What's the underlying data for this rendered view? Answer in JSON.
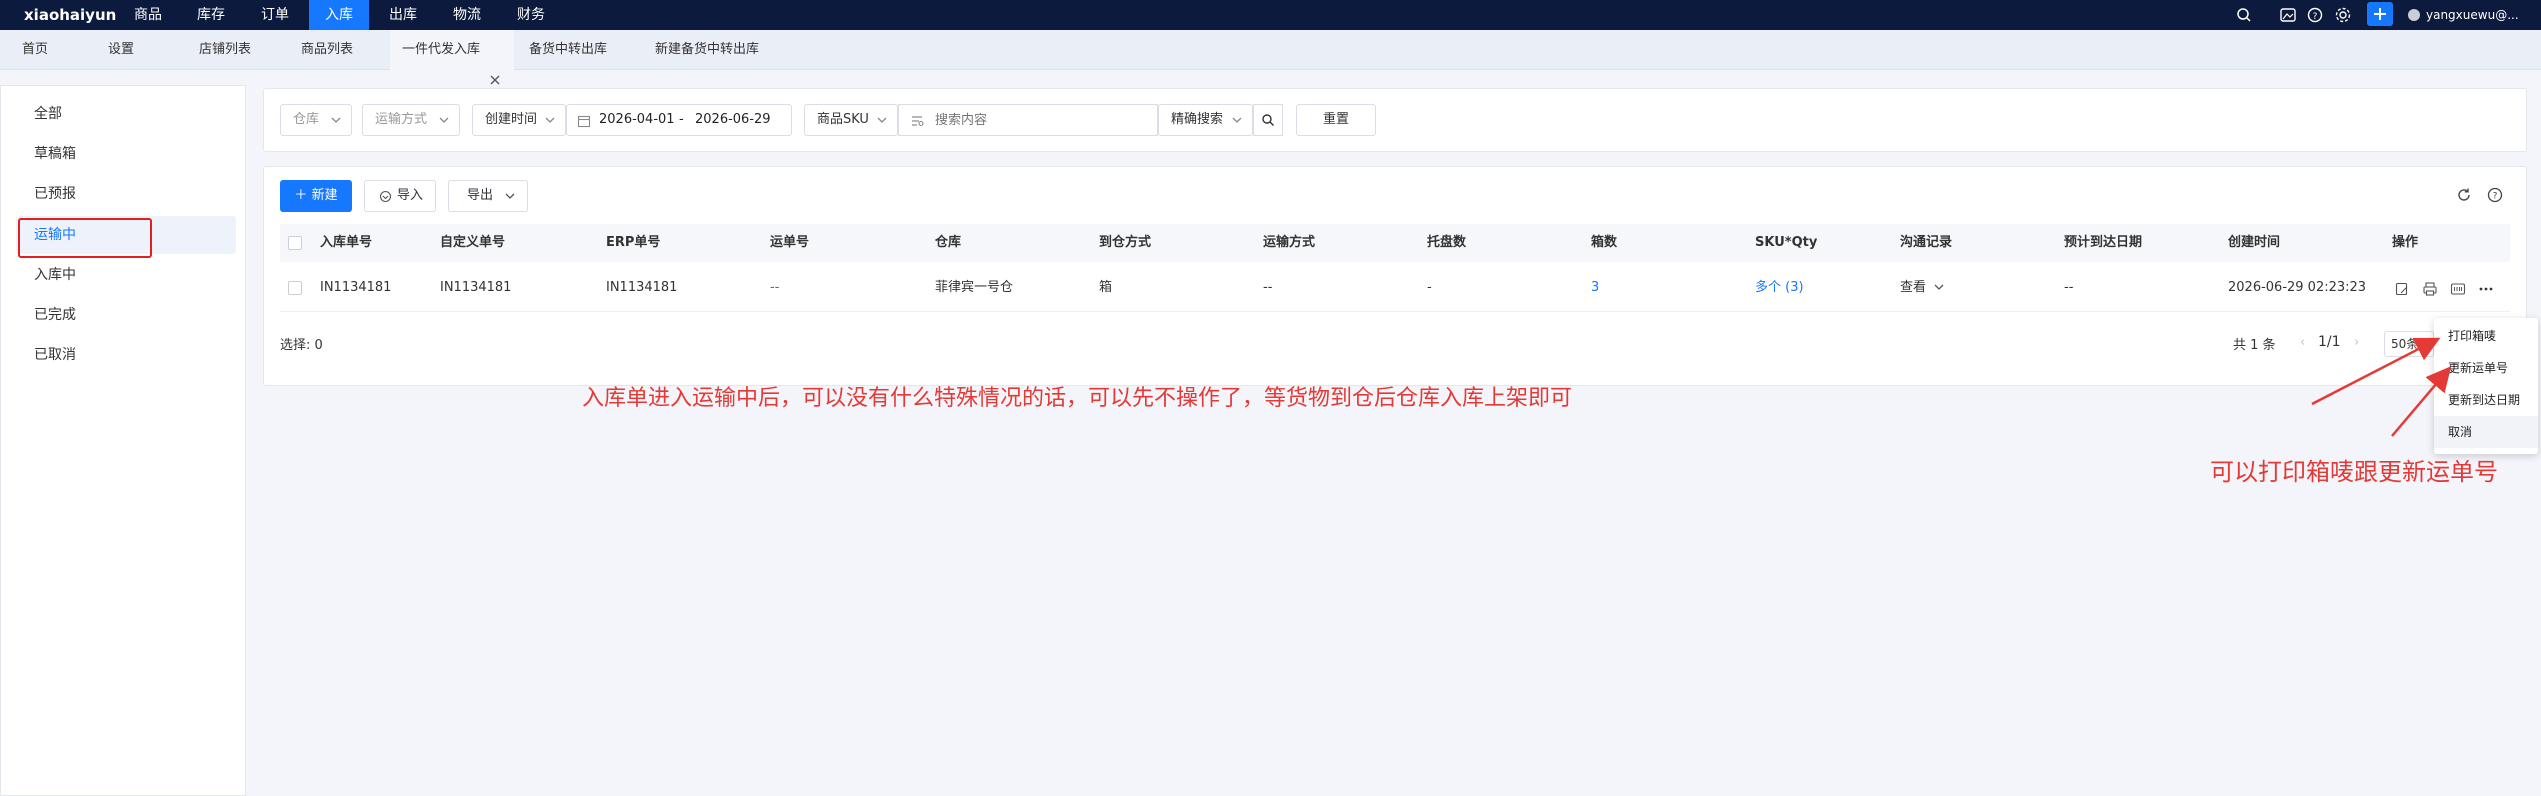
{
  "brand": "xiaohaiyun",
  "nav": [
    {
      "label": "商品"
    },
    {
      "label": "库存"
    },
    {
      "label": "订单"
    },
    {
      "label": "入库",
      "active": true
    },
    {
      "label": "出库"
    },
    {
      "label": "物流"
    },
    {
      "label": "财务"
    }
  ],
  "user": "yangxuewu@...",
  "tabs": [
    {
      "label": "首页"
    },
    {
      "label": "设置"
    },
    {
      "label": "店铺列表"
    },
    {
      "label": "商品列表"
    },
    {
      "label": "一件代发入库",
      "active": true
    },
    {
      "label": "备货中转出库"
    },
    {
      "label": "新建备货中转出库"
    }
  ],
  "sidebar": [
    {
      "label": "全部"
    },
    {
      "label": "草稿箱"
    },
    {
      "label": "已预报"
    },
    {
      "label": "运输中",
      "active": true
    },
    {
      "label": "入库中"
    },
    {
      "label": "已完成"
    },
    {
      "label": "已取消"
    }
  ],
  "filters": {
    "warehouse_placeholder": "仓库",
    "shipping_placeholder": "运输方式",
    "time_type": "创建时间",
    "date_start": "2026-04-01",
    "date_sep": "-",
    "date_end": "2026-06-29",
    "field_type": "商品SKU",
    "search_placeholder": "搜索内容",
    "match_mode": "精确搜索",
    "reset_label": "重置"
  },
  "toolbar": {
    "new_label": "新建",
    "import_label": "导入",
    "export_label": "导出"
  },
  "table": {
    "columns": [
      "入库单号",
      "自定义单号",
      "ERP单号",
      "运单号",
      "仓库",
      "到仓方式",
      "运输方式",
      "托盘数",
      "箱数",
      "SKU*Qty",
      "沟通记录",
      "预计到达日期",
      "创建时间",
      "操作"
    ],
    "rows": [
      {
        "inbound_no": "IN1134181",
        "custom_no": "IN1134181",
        "erp_no": "IN1134181",
        "waybill": "--",
        "warehouse": "菲律宾一号仓",
        "arrival_mode": "箱",
        "shipping": "--",
        "pallets": "-",
        "boxes": "3",
        "sku_qty": "多个 (3)",
        "comm": "查看",
        "eta": "--",
        "created": "2026-06-29 02:23:23"
      }
    ]
  },
  "footer": {
    "selected": "选择: 0",
    "total": "共 1 条",
    "page": "1/1",
    "page_size": "50条"
  },
  "dropdown": [
    {
      "label": "打印箱唛"
    },
    {
      "label": "更新运单号"
    },
    {
      "label": "更新到达日期"
    },
    {
      "label": "取消"
    }
  ],
  "annotations": {
    "note1": "入库单进入运输中后，可以没有什么特殊情况的话，可以先不操作了，等货物到仓后仓库入库上架即可",
    "note2": "可以打印箱唛跟更新运单号"
  },
  "colors": {
    "nav_bg": "#0c1a3d",
    "accent": "#1677ff",
    "annotation": "#e53935"
  }
}
